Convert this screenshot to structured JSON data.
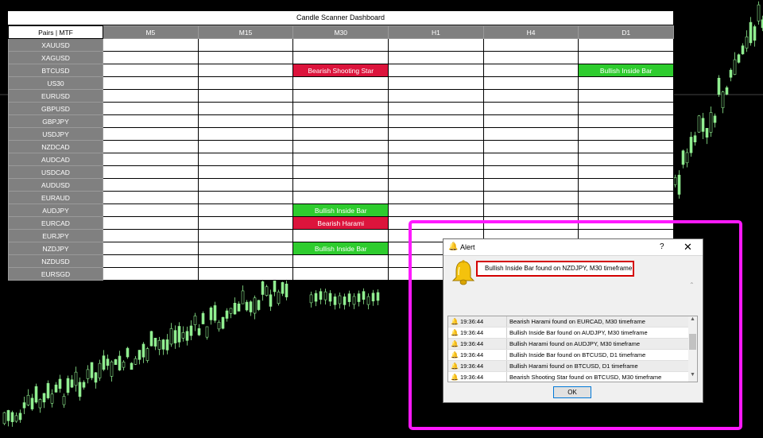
{
  "dashboard": {
    "title": "Candle Scanner Dashboard",
    "corner_label": "Pairs | MTF",
    "timeframes": [
      "M5",
      "M15",
      "M30",
      "H1",
      "H4",
      "D1"
    ],
    "pairs": [
      "XAUUSD",
      "XAGUSD",
      "BTCUSD",
      "US30",
      "EURUSD",
      "GBPUSD",
      "GBPJPY",
      "USDJPY",
      "NZDCAD",
      "AUDCAD",
      "USDCAD",
      "AUDUSD",
      "EURAUD",
      "AUDJPY",
      "EURCAD",
      "EURJPY",
      "NZDJPY",
      "NZDUSD",
      "EURSGD"
    ],
    "signals": [
      {
        "pair": "BTCUSD",
        "timeframe": "M30",
        "label": "Bearish Shooting Star",
        "kind": "bearish"
      },
      {
        "pair": "BTCUSD",
        "timeframe": "D1",
        "label": "Bullish Inside Bar",
        "kind": "bullish"
      },
      {
        "pair": "AUDJPY",
        "timeframe": "M30",
        "label": "Bullish Inside Bar",
        "kind": "bullish"
      },
      {
        "pair": "EURCAD",
        "timeframe": "M30",
        "label": "Bearish Harami",
        "kind": "bearish"
      },
      {
        "pair": "NZDJPY",
        "timeframe": "M30",
        "label": "Bullish Inside Bar",
        "kind": "bullish"
      }
    ]
  },
  "colors": {
    "bullish": "#2ecc2e",
    "bearish": "#dc143c",
    "header_gray": "#808080",
    "highlight": "#ff19ff",
    "candle": "#90ee90"
  },
  "alert": {
    "title": "Alert",
    "help_label": "?",
    "close_label": "✕",
    "icon": "bell-icon",
    "message": "Bullish Inside Bar found on NZDJPY, M30 timeframe",
    "log": [
      {
        "time": "19:36:44",
        "message": "Bearish Harami found on EURCAD, M30 timeframe"
      },
      {
        "time": "19:36:44",
        "message": "Bullish Inside Bar found on AUDJPY, M30 timeframe"
      },
      {
        "time": "19:36:44",
        "message": "Bullish Harami found on AUDJPY, M30 timeframe"
      },
      {
        "time": "19:36:44",
        "message": "Bullish Inside Bar found on BTCUSD, D1 timeframe"
      },
      {
        "time": "19:36:44",
        "message": "Bullish Harami found on BTCUSD, D1 timeframe"
      },
      {
        "time": "19:36:44",
        "message": "Bearish Shooting Star found on BTCUSD, M30 timeframe"
      }
    ],
    "ok_label": "OK"
  }
}
